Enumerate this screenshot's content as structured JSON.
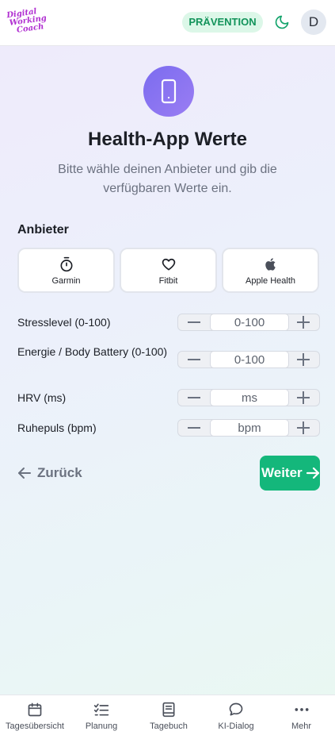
{
  "header": {
    "logo_lines": [
      "Digital",
      "Working",
      "Coach"
    ],
    "badge": "PRÄVENTION",
    "avatar_initial": "D",
    "theme_icon": "moon-icon"
  },
  "hero": {
    "icon": "smartphone-icon",
    "title": "Health-App Werte",
    "subtitle": "Bitte wähle deinen Anbieter und gib die verfügbaren Werte ein."
  },
  "providers": {
    "label": "Anbieter",
    "items": [
      {
        "label": "Garmin",
        "icon": "stopwatch-icon"
      },
      {
        "label": "Fitbit",
        "icon": "heart-icon"
      },
      {
        "label": "Apple Health",
        "icon": "apple-icon"
      }
    ]
  },
  "fields": [
    {
      "label": "Stresslevel (0-100)",
      "placeholder": "0-100"
    },
    {
      "label": "Energie / Body Battery (0-100)",
      "placeholder": "0-100"
    },
    {
      "label": "HRV (ms)",
      "placeholder": "ms"
    },
    {
      "label": "Ruhepuls (bpm)",
      "placeholder": "bpm"
    }
  ],
  "actions": {
    "back": "Zurück",
    "next": "Weiter"
  },
  "nav": [
    {
      "label": "Tagesübersicht",
      "icon": "calendar-icon"
    },
    {
      "label": "Planung",
      "icon": "checklist-icon"
    },
    {
      "label": "Tagebuch",
      "icon": "book-icon"
    },
    {
      "label": "KI-Dialog",
      "icon": "chat-icon"
    },
    {
      "label": "Mehr",
      "icon": "more-icon"
    }
  ],
  "colors": {
    "accent": "#14b77b",
    "badge_bg": "#dcf7e8",
    "badge_text": "#12935a",
    "hero_icon": "#8572f0",
    "logo": "#b02fd1"
  }
}
